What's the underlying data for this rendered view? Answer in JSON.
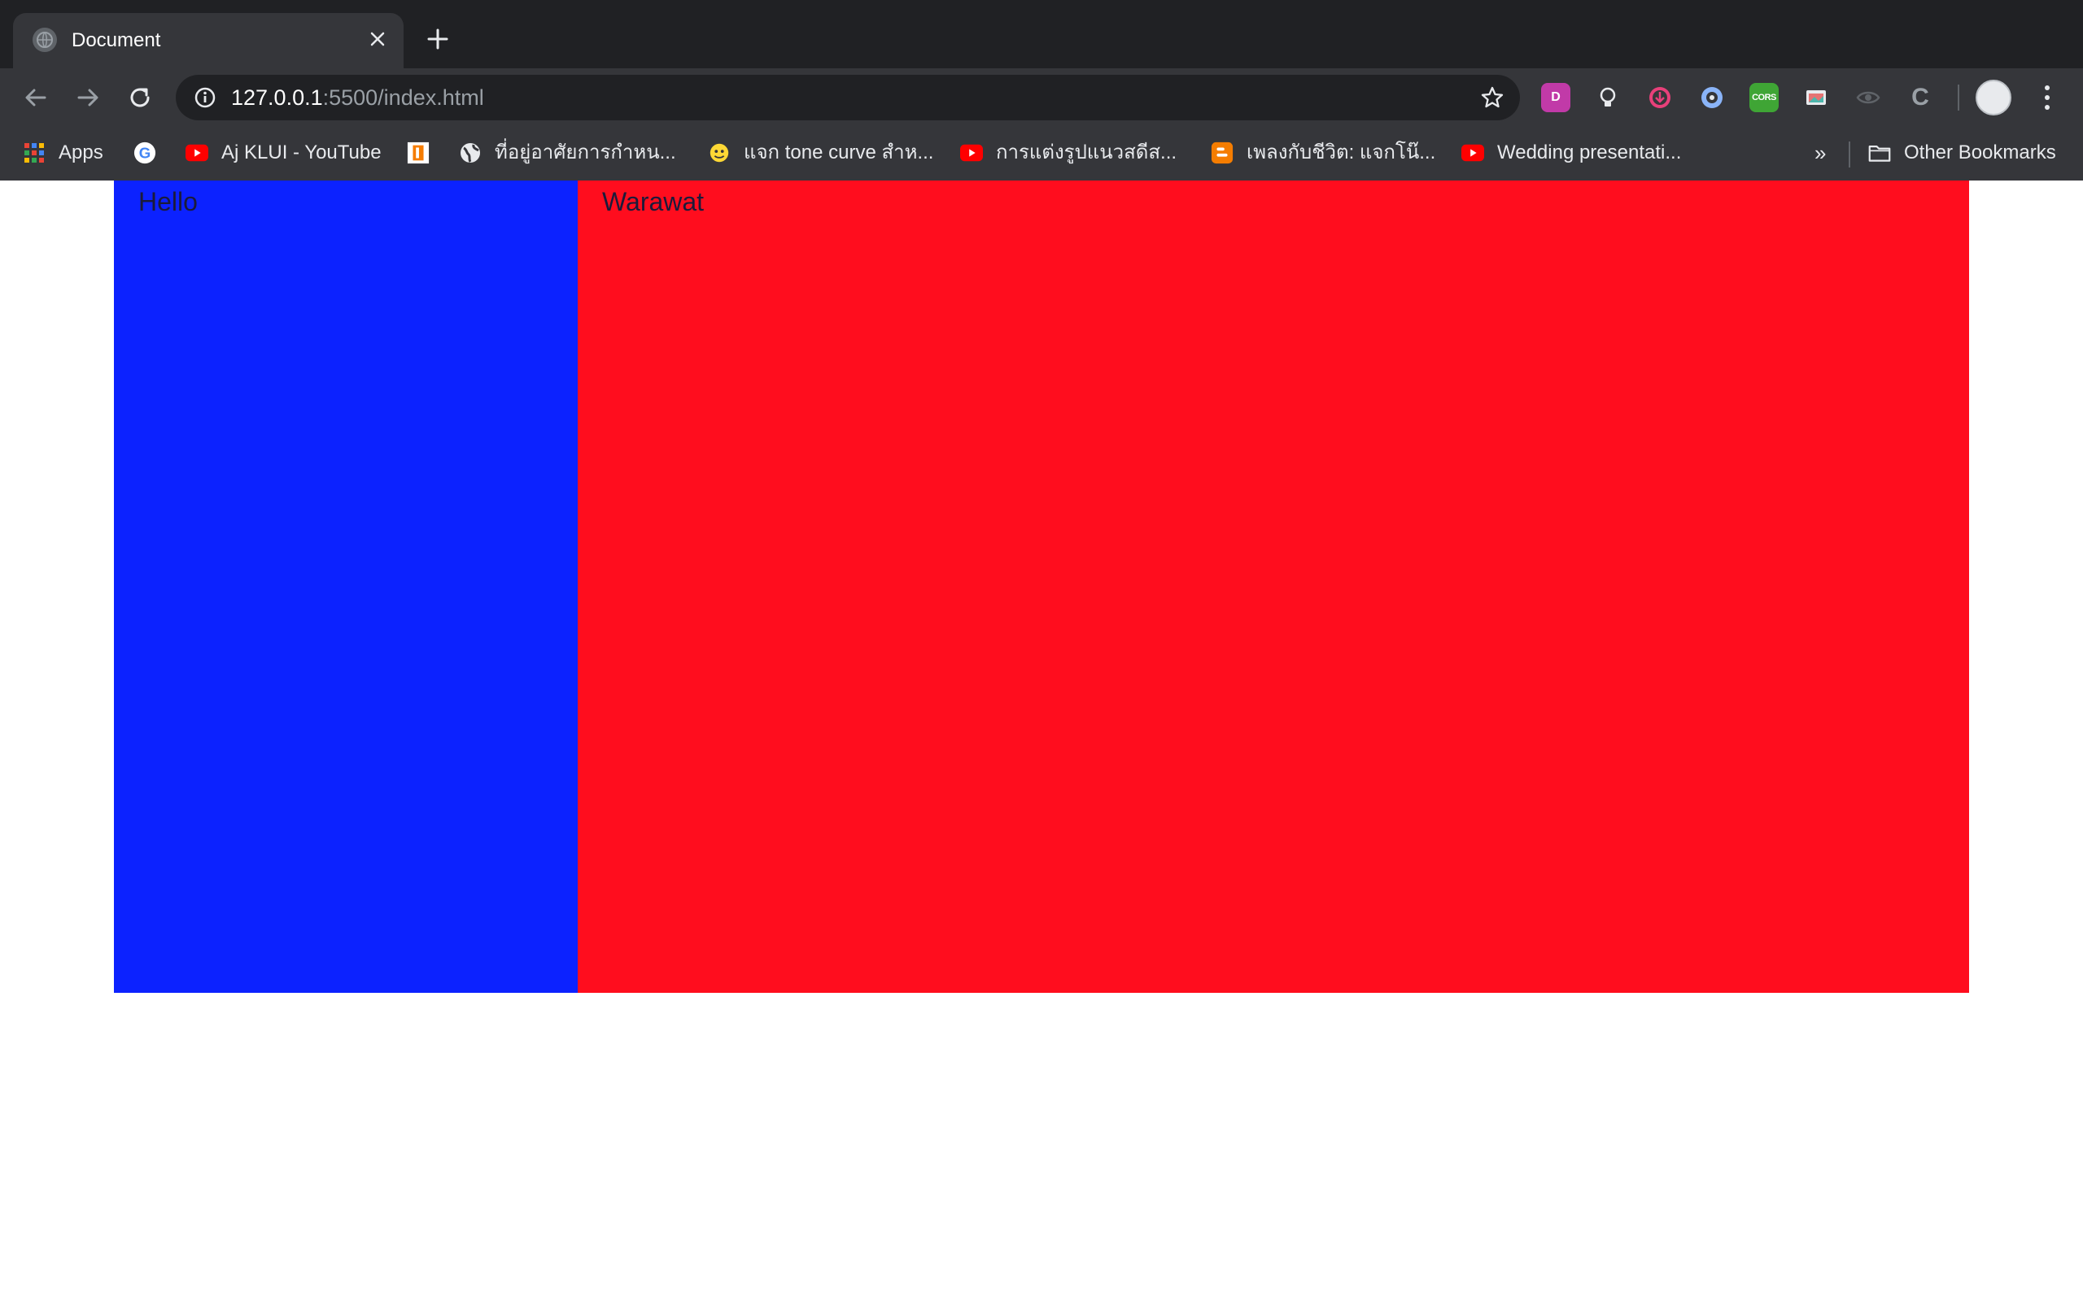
{
  "browser": {
    "tab": {
      "title": "Document",
      "favicon": "globe-icon"
    },
    "new_tab_icon": "plus-icon",
    "nav": {
      "back_icon": "back-arrow-icon",
      "forward_icon": "forward-arrow-icon",
      "reload_icon": "reload-icon"
    },
    "address": {
      "host": "127.0.0.1",
      "rest": ":5500/index.html",
      "info_icon": "info-icon",
      "bookmark_icon": "star-icon"
    },
    "extensions": [
      {
        "name": "d-extension-icon",
        "letter": "D",
        "color": "#c13aa8"
      },
      {
        "name": "bulb-extension-icon",
        "letter": "",
        "color": "#e8eaed"
      },
      {
        "name": "download-extension-icon",
        "letter": "",
        "color": "#e8407a"
      },
      {
        "name": "circle-extension-icon",
        "letter": "",
        "color": "#8ab4f8"
      },
      {
        "name": "cors-extension-icon",
        "letter": "CORS",
        "color": "#3fa535"
      },
      {
        "name": "screenshot-extension-icon",
        "letter": "",
        "color": "#e57373"
      },
      {
        "name": "eye-extension-icon",
        "letter": "",
        "color": "#5f6368"
      },
      {
        "name": "c-extension-icon",
        "letter": "C",
        "color": "#9aa0a6"
      }
    ],
    "bookmarks": [
      {
        "label": "Apps",
        "icon": "apps-grid-icon"
      },
      {
        "label": "",
        "icon": "google-icon"
      },
      {
        "label": "Aj KLUI - YouTube",
        "icon": "youtube-icon"
      },
      {
        "label": "",
        "icon": "bookmark-orange-icon"
      },
      {
        "label": "ที่อยู่อาศัยการกำหน...",
        "icon": "globe-icon"
      },
      {
        "label": "แจก tone curve สำห...",
        "icon": "emoji-icon"
      },
      {
        "label": "การแต่งรูปแนวสดีส...",
        "icon": "youtube-icon"
      },
      {
        "label": "เพลงกับชีวิต: แจกโน๊...",
        "icon": "blogger-icon"
      },
      {
        "label": "Wedding presentati...",
        "icon": "youtube-icon"
      }
    ],
    "overflow_label": "»",
    "other_bookmarks": {
      "label": "Other Bookmarks",
      "icon": "folder-icon"
    }
  },
  "page": {
    "left_text": "Hello",
    "right_text": "Warawat",
    "left_color": "#0c22ff",
    "right_color": "#ff0d1e"
  }
}
